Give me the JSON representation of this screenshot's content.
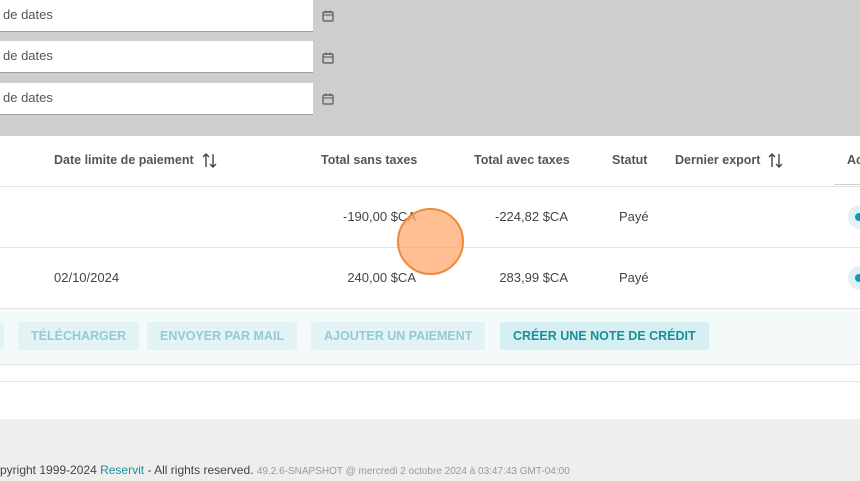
{
  "filters": {
    "date_placeholder_1": "de dates",
    "date_placeholder_2": "de dates",
    "date_placeholder_3": "de dates"
  },
  "table": {
    "headers": {
      "due_date": "Date limite de paiement",
      "total_excl_tax": "Total sans taxes",
      "total_incl_tax": "Total avec taxes",
      "status": "Statut",
      "last_export": "Dernier export",
      "actions": "Ac"
    },
    "rows": [
      {
        "due_date": "",
        "total_excl_tax": "-190,00 $CA",
        "total_incl_tax": "-224,82 $CA",
        "status": "Payé",
        "last_export": ""
      },
      {
        "due_date": "02/10/2024",
        "total_excl_tax": "240,00 $CA",
        "total_incl_tax": "283,99 $CA",
        "status": "Payé",
        "last_export": ""
      }
    ]
  },
  "actions": {
    "download": "Télécharger",
    "send_email": "Envoyer par mail",
    "add_payment": "Ajouter un paiement",
    "create_credit_note": "Créer une note de crédit"
  },
  "footer": {
    "copyright": "pyright 1999-2024",
    "brand": "Reservit",
    "rights": "- All rights reserved.",
    "version": "49.2.6-SNAPSHOT @ mercredi 2 octobre 2024 à 03:47:43 GMT-04:00"
  },
  "colors": {
    "accent": "#1a8f9c",
    "filter_background": "#cecece",
    "click_marker": "#ee8a3c"
  }
}
